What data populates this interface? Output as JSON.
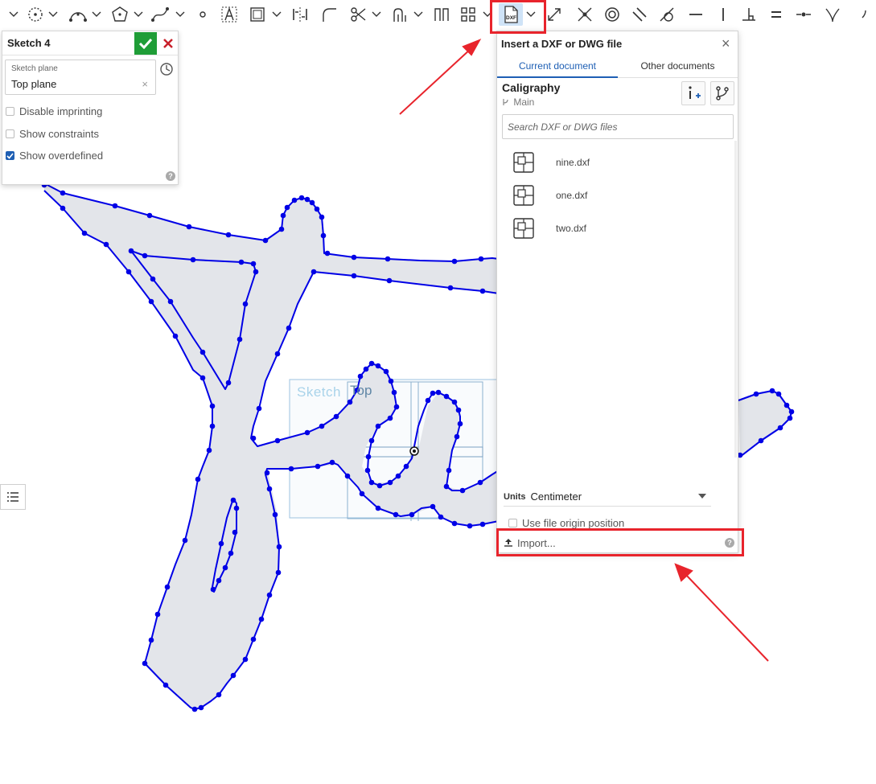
{
  "toolbar": {
    "items": [
      "dropdown-arrow-icon",
      "circle-icon",
      "arc-icon",
      "polygon-icon",
      "spline-icon",
      "point-icon",
      "text-icon",
      "rectangle-tool-icon",
      "mirror-constraint-icon",
      "fillet-icon",
      "trim-icon",
      "use-icon",
      "offset-icon",
      "pattern-icon",
      "insert-dxf-icon",
      "dimension-icon",
      "coincident-icon",
      "concentric-icon",
      "parallel-icon",
      "tangent-icon",
      "horizontal-icon",
      "vertical-icon",
      "perpendicular-icon",
      "equal-icon",
      "midpoint-icon",
      "normal-icon"
    ],
    "dxf_button_label": "DXF"
  },
  "sketch_panel": {
    "title": "Sketch 4",
    "plane_label": "Sketch plane",
    "plane_value": "Top plane",
    "clear_glyph": "×",
    "options": [
      {
        "label": "Disable imprinting",
        "checked": false
      },
      {
        "label": "Show constraints",
        "checked": false
      },
      {
        "label": "Show overdefined",
        "checked": true
      }
    ],
    "help": "?"
  },
  "canvas": {
    "sketch_label": "Sketch",
    "plane_label": "Top"
  },
  "dxf_dialog": {
    "title": "Insert a DXF or DWG file",
    "close": "×",
    "tabs": [
      "Current document",
      "Other documents"
    ],
    "document_name": "Caligraphy",
    "branch": "Main",
    "search_placeholder": "Search DXF or DWG files",
    "files": [
      "nine.dxf",
      "one.dxf",
      "two.dxf"
    ],
    "units_label": "Units",
    "units_value": "Centimeter",
    "origin_option": "Use file origin position",
    "import_label": "Import...",
    "help": "?"
  },
  "colors": {
    "accent_blue": "#1e5fb4",
    "sketch_blue": "#0000e6",
    "region_fill": "#e3e5ea",
    "ok_green": "#1f9d37",
    "cancel_red": "#c8202a",
    "highlight_red": "#e8242c"
  }
}
